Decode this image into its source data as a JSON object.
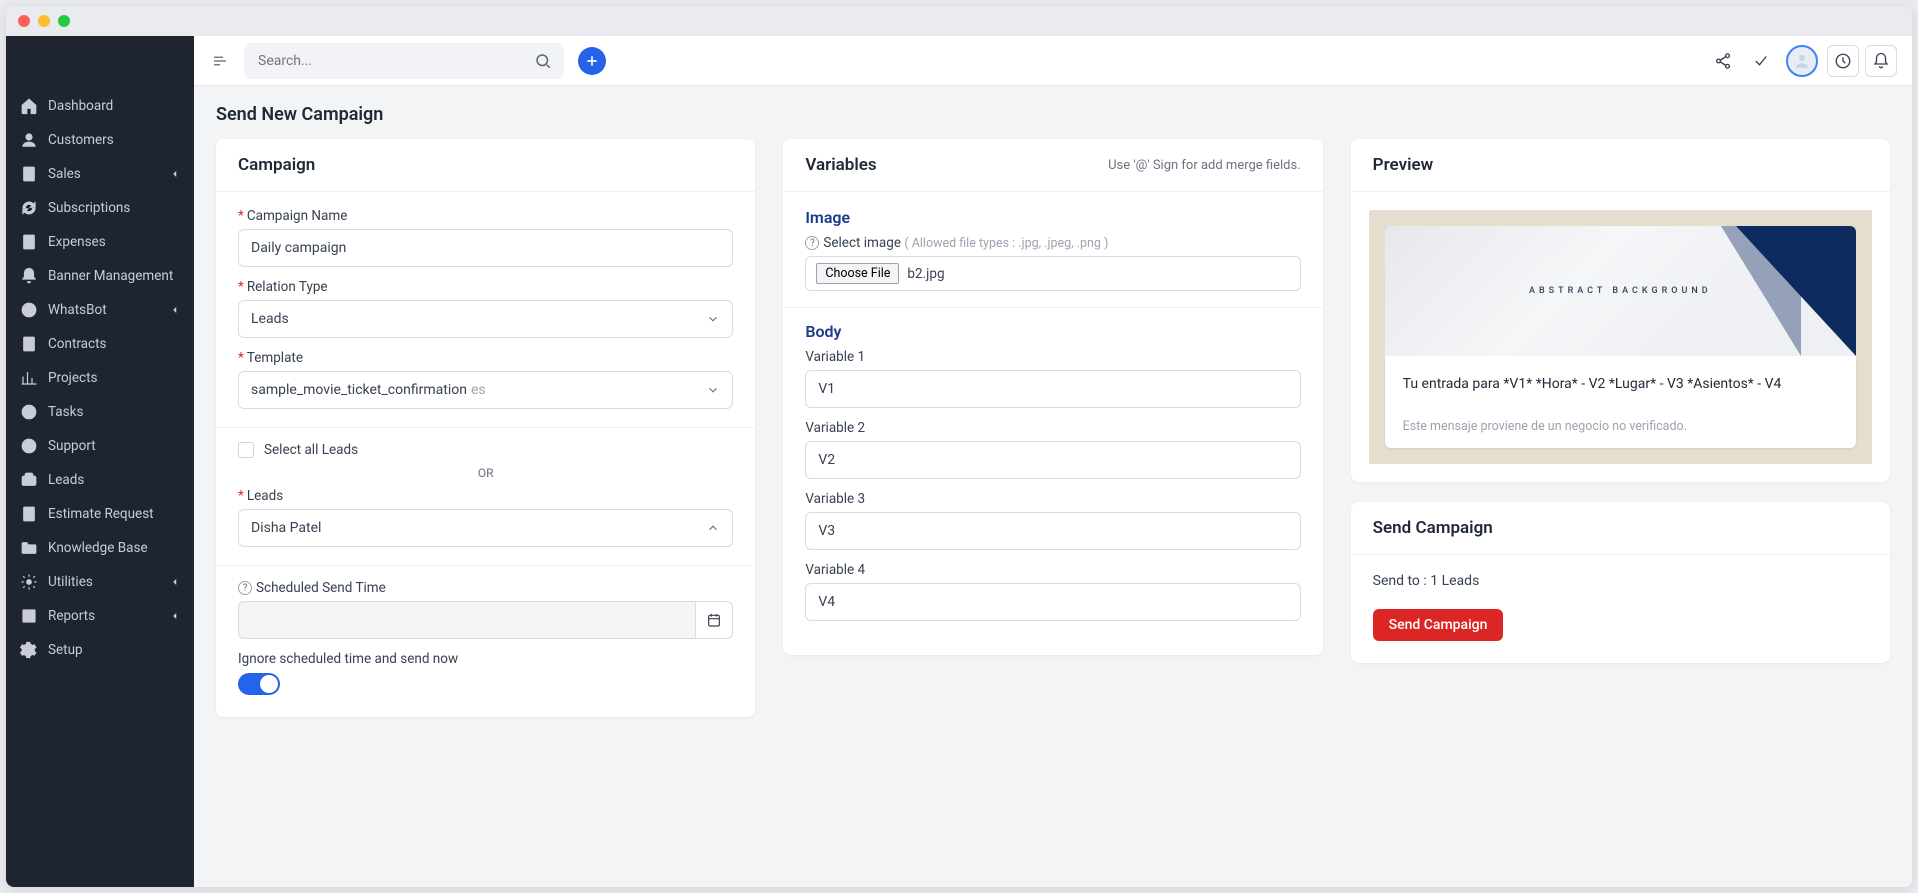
{
  "sidebar": {
    "items": [
      {
        "label": "Dashboard",
        "icon": "home"
      },
      {
        "label": "Customers",
        "icon": "user"
      },
      {
        "label": "Sales",
        "icon": "file",
        "chev": true
      },
      {
        "label": "Subscriptions",
        "icon": "refresh"
      },
      {
        "label": "Expenses",
        "icon": "doc"
      },
      {
        "label": "Banner Management",
        "icon": "bell"
      },
      {
        "label": "WhatsBot",
        "icon": "whatsapp",
        "chev": true
      },
      {
        "label": "Contracts",
        "icon": "doc"
      },
      {
        "label": "Projects",
        "icon": "chart"
      },
      {
        "label": "Tasks",
        "icon": "check"
      },
      {
        "label": "Support",
        "icon": "support"
      },
      {
        "label": "Leads",
        "icon": "leads"
      },
      {
        "label": "Estimate Request",
        "icon": "doc"
      },
      {
        "label": "Knowledge Base",
        "icon": "folder"
      },
      {
        "label": "Utilities",
        "icon": "gear",
        "chev": true
      },
      {
        "label": "Reports",
        "icon": "report",
        "chev": true
      },
      {
        "label": "Setup",
        "icon": "cog"
      }
    ]
  },
  "topbar": {
    "search_placeholder": "Search..."
  },
  "page": {
    "title": "Send New Campaign"
  },
  "campaign": {
    "title": "Campaign",
    "name_label": "Campaign Name",
    "name_value": "Daily campaign",
    "relation_label": "Relation Type",
    "relation_value": "Leads",
    "template_label": "Template",
    "template_value": "sample_movie_ticket_confirmation",
    "template_sub": "es",
    "select_all_label": "Select all Leads",
    "or": "OR",
    "leads_label": "Leads",
    "leads_value": "Disha Patel",
    "scheduled_label": "Scheduled Send Time",
    "ignore_label": "Ignore scheduled time and send now"
  },
  "variables": {
    "title": "Variables",
    "hint": "Use '@' Sign for add merge fields.",
    "image_title": "Image",
    "select_image_label": "Select image",
    "allowed": "( Allowed file types : .jpg, .jpeg, .png )",
    "file_button": "Choose File",
    "file_name": "b2.jpg",
    "body_title": "Body",
    "vars": [
      {
        "label": "Variable 1",
        "value": "V1"
      },
      {
        "label": "Variable 2",
        "value": "V2"
      },
      {
        "label": "Variable 3",
        "value": "V3"
      },
      {
        "label": "Variable 4",
        "value": "V4"
      }
    ]
  },
  "preview": {
    "title": "Preview",
    "img_label": "ABSTRACT BACKGROUND",
    "body": "Tu entrada para *V1* *Hora* - V2 *Lugar* - V3 *Asientos* - V4",
    "foot": "Este mensaje proviene de un negocio no verificado."
  },
  "send": {
    "title": "Send Campaign",
    "info": "Send to : 1 Leads",
    "button": "Send Campaign"
  }
}
